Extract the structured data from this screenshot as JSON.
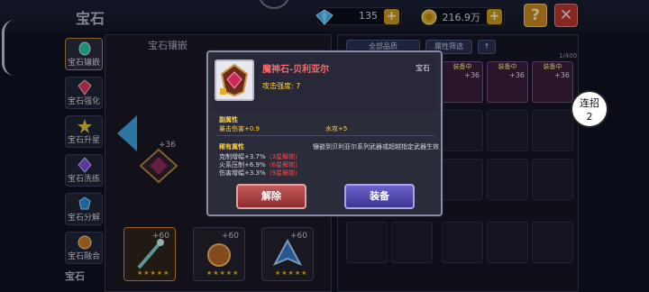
{
  "screen_title": "宝石",
  "currencies": [
    {
      "name": "diamond",
      "icon": "diamond-icon",
      "value": "135"
    },
    {
      "name": "gold",
      "icon": "gold-coin-icon",
      "value": "216.9万"
    }
  ],
  "top_buttons": {
    "help": "?",
    "close": "✕"
  },
  "tabs": [
    {
      "label": "宝石镶嵌",
      "active": true
    },
    {
      "label": "宝石强化",
      "active": false
    },
    {
      "label": "宝石升星",
      "active": false
    },
    {
      "label": "宝石洗练",
      "active": false
    },
    {
      "label": "宝石分解",
      "active": false
    },
    {
      "label": "宝石融合",
      "active": false
    }
  ],
  "board": {
    "header": "宝石镶嵌",
    "center_gem_level": "+36",
    "bottom_slots": [
      {
        "level": "+60",
        "stars": "★★★★★"
      },
      {
        "level": "+60",
        "stars": "★★★★★"
      },
      {
        "level": "+60",
        "stars": "★★★★★"
      }
    ]
  },
  "inventory": {
    "filter_all": "全部品质",
    "filter_attr": "属性筛选",
    "sort": "↑",
    "count": "1/400",
    "equipped_tag": "装备中",
    "equipped": [
      {
        "level": "+36"
      },
      {
        "level": "+36"
      },
      {
        "level": "+36"
      }
    ]
  },
  "combo": {
    "label": "连招",
    "count": "2"
  },
  "dialog": {
    "gem_name": "魔神石-贝利亚尔",
    "gem_type": "宝石",
    "attack_strength": "攻击强度: 7",
    "sub_attr_title": "副属性",
    "sub_attrs": [
      "暴击伤害+0.9",
      "水攻+5"
    ],
    "rare_attr_title": "稀有属性",
    "rare_note": "镶嵌到贝利亚尔系列武器或超越指定武器生效",
    "rare_attrs": [
      {
        "text": "克制增幅+3.7%",
        "lock": "（3星解锁）"
      },
      {
        "text": "火系压制+6.9%",
        "lock": "（6星解锁）"
      },
      {
        "text": "伤害增幅+3.3%",
        "lock": "（9星解锁）"
      }
    ],
    "remove_label": "解除",
    "equip_label": "装备"
  },
  "colors": {
    "gem_name": "#ff6a6a",
    "highlight": "#ffd24a",
    "remove_button": "#b34a4e",
    "equip_button": "#5a52b8",
    "arrow": "#3da6e0"
  }
}
